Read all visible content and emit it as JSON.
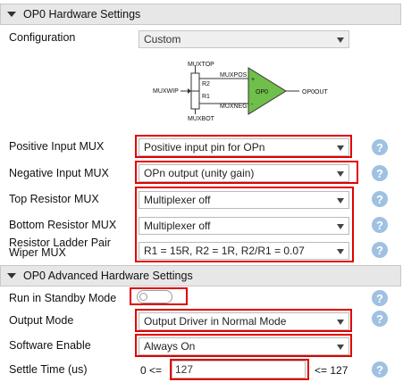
{
  "hw_section": {
    "title": "OP0 Hardware Settings"
  },
  "configuration": {
    "label": "Configuration",
    "value": "Custom"
  },
  "diagram": {
    "labels": {
      "muxtop": "MUXTOP",
      "muxwip": "MUXWIP",
      "r2": "R2",
      "r1": "R1",
      "muxbot": "MUXBOT",
      "muxpos": "MUXPOS",
      "muxneg": "MUXNEG",
      "plus": "+",
      "minus": "-",
      "amp": "OP0",
      "out": "OP0OUT"
    },
    "amp_color": "#6fbf4a"
  },
  "fields": [
    {
      "label": "Positive Input MUX",
      "value": "Positive input pin for OPn"
    },
    {
      "label": "Negative Input MUX",
      "value": "OPn output (unity gain)"
    },
    {
      "label": "Top Resistor MUX",
      "value": "Multiplexer off"
    },
    {
      "label": "Bottom Resistor MUX",
      "value": "Multiplexer off"
    },
    {
      "label": "Resistor Ladder Pair Wiper MUX",
      "label_line1": "Resistor Ladder Pair",
      "label_line2": "Wiper MUX",
      "value": "R1 = 15R, R2 = 1R, R2/R1 = 0.07"
    }
  ],
  "adv_section": {
    "title": "OP0 Advanced Hardware Settings"
  },
  "standby": {
    "label": "Run in Standby Mode",
    "enabled": false
  },
  "output_mode": {
    "label": "Output Mode",
    "value": "Output Driver in Normal Mode"
  },
  "software_enable": {
    "label": "Software Enable",
    "value": "Always On"
  },
  "settle_time": {
    "label": "Settle Time (us)",
    "min_text": "0 <=",
    "value": "127",
    "max_text": "<= 127"
  },
  "help_glyph": "?",
  "colors": {
    "highlight": "#e00000",
    "help": "#9fc1e2",
    "header_bg": "#e7e7e7"
  }
}
